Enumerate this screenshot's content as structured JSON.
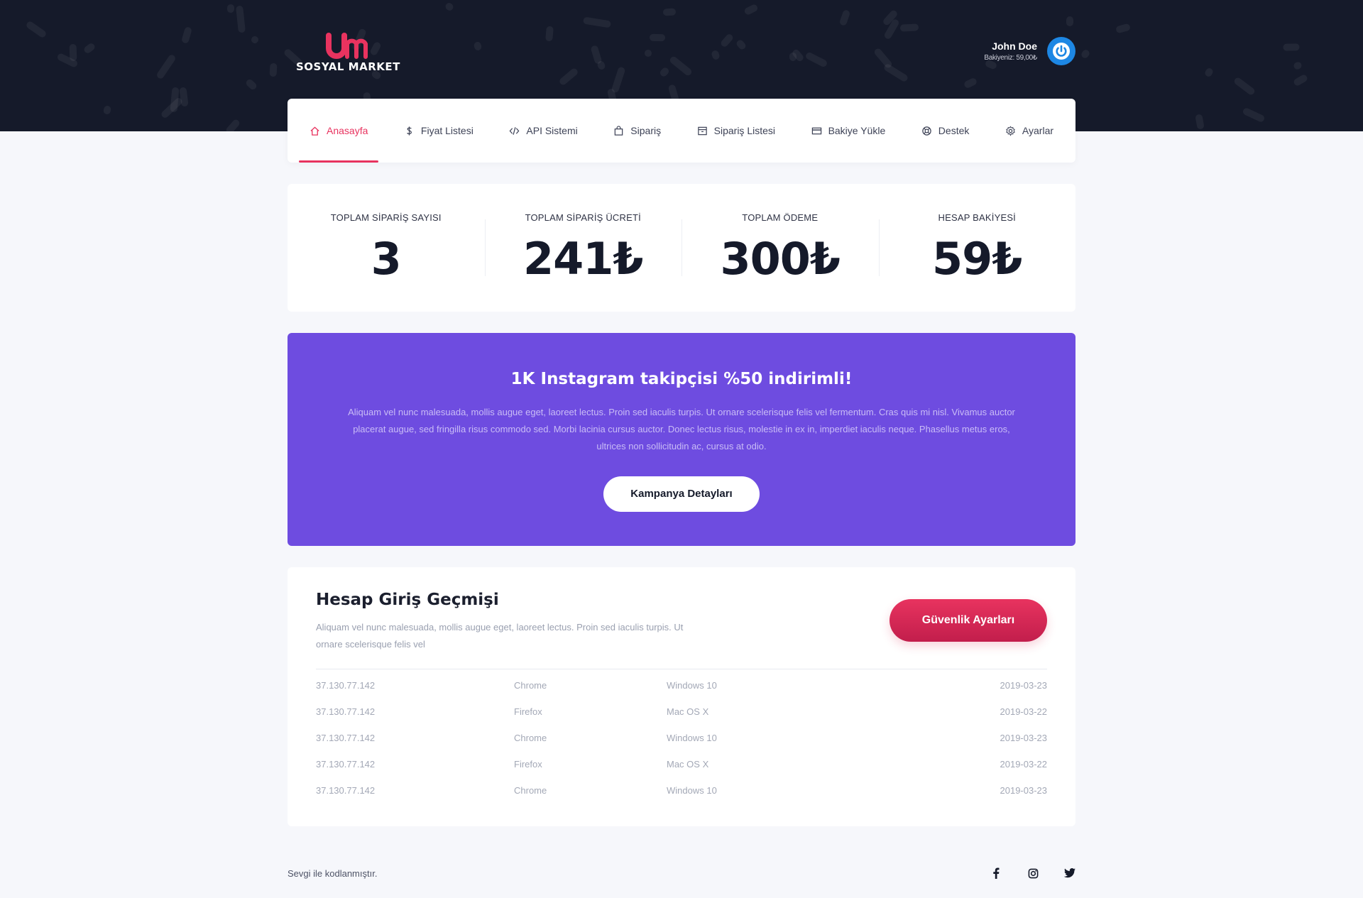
{
  "brand": {
    "name": "SOSYAL MARKET",
    "logo_mark": "um",
    "accent": "#e8335f",
    "topbar_color": "#151a2a",
    "campaign_color": "#6e4ce0"
  },
  "user": {
    "name": "John Doe",
    "balance": "Bakiyeniz: 59,00₺",
    "icon": "power-icon"
  },
  "nav": {
    "items": [
      {
        "label": "Anasayfa",
        "icon": "home-icon",
        "active": true
      },
      {
        "label": "Fiyat Listesi",
        "icon": "dollar-icon"
      },
      {
        "label": "API Sistemi",
        "icon": "code-icon"
      },
      {
        "label": "Sipariş",
        "icon": "bag-icon"
      },
      {
        "label": "Sipariş Listesi",
        "icon": "archive-icon"
      },
      {
        "label": "Bakiye Yükle",
        "icon": "credit-card-icon"
      },
      {
        "label": "Destek",
        "icon": "lifebuoy-icon"
      },
      {
        "label": "Ayarlar",
        "icon": "gear-icon"
      }
    ]
  },
  "stats": [
    {
      "label": "TOPLAM SİPARİŞ SAYISI",
      "value": "3"
    },
    {
      "label": "TOPLAM SİPARİŞ ÜCRETİ",
      "value": "241₺"
    },
    {
      "label": "TOPLAM ÖDEME",
      "value": "300₺"
    },
    {
      "label": "HESAP BAKİYESİ",
      "value": "59₺"
    }
  ],
  "campaign": {
    "title": "1K Instagram takipçisi %50 indirimli!",
    "text": "Aliquam vel nunc malesuada, mollis augue eget, laoreet lectus. Proin sed iaculis turpis. Ut ornare scelerisque felis vel fermentum. Cras quis mi nisl. Vivamus auctor placerat augue, sed fringilla risus commodo sed. Morbi lacinia cursus auctor. Donec lectus risus, molestie in ex in, imperdiet iaculis neque. Phasellus metus eros, ultrices non sollicitudin ac, cursus at odio.",
    "button": "Kampanya Detayları"
  },
  "history": {
    "title": "Hesap Giriş Geçmişi",
    "description": "Aliquam vel nunc malesuada, mollis augue eget, laoreet lectus. Proin sed iaculis turpis. Ut ornare scelerisque felis vel",
    "button": "Güvenlik Ayarları",
    "rows": [
      {
        "ip": "37.130.77.142",
        "browser": "Chrome",
        "os": "Windows 10",
        "date": "2019-03-23"
      },
      {
        "ip": "37.130.77.142",
        "browser": "Firefox",
        "os": "Mac OS X",
        "date": "2019-03-22"
      },
      {
        "ip": "37.130.77.142",
        "browser": "Chrome",
        "os": "Windows 10",
        "date": "2019-03-23"
      },
      {
        "ip": "37.130.77.142",
        "browser": "Firefox",
        "os": "Mac OS X",
        "date": "2019-03-22"
      },
      {
        "ip": "37.130.77.142",
        "browser": "Chrome",
        "os": "Windows 10",
        "date": "2019-03-23"
      }
    ]
  },
  "footer": {
    "text": "Sevgi ile kodlanmıştır.",
    "socials": [
      "facebook-icon",
      "instagram-icon",
      "twitter-icon"
    ]
  }
}
